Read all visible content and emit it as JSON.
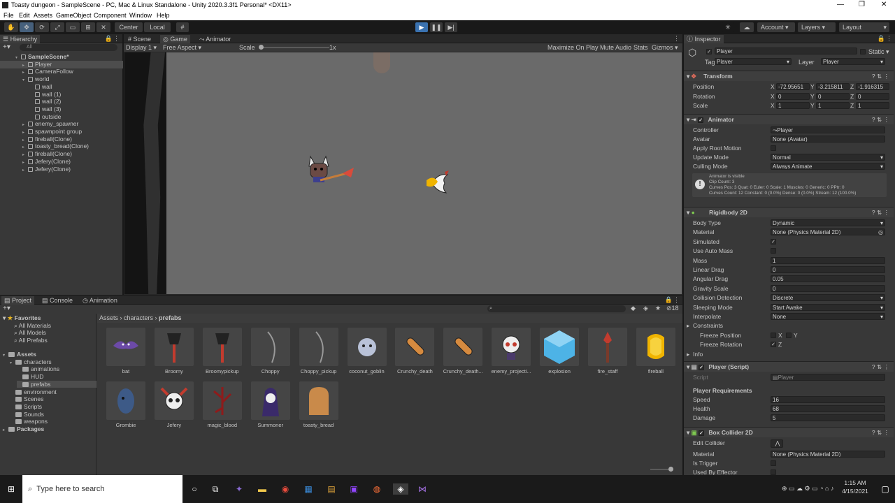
{
  "window": {
    "title": "Toasty dungeon - SampleScene - PC, Mac & Linux Standalone - Unity 2020.3.3f1 Personal* <DX11>"
  },
  "menu": [
    "File",
    "Edit",
    "Assets",
    "GameObject",
    "Component",
    "Window",
    "Help"
  ],
  "toolbar": {
    "center": "Center",
    "local": "Local",
    "account": "Account",
    "layers": "Layers",
    "layout": "Layout"
  },
  "hierarchy": {
    "title": "Hierarchy",
    "search_placeholder": "All",
    "items": [
      {
        "label": "SampleScene*",
        "indent": 0
      },
      {
        "label": "Player",
        "indent": 1
      },
      {
        "label": "CameraFollow",
        "indent": 1
      },
      {
        "label": "world",
        "indent": 1
      },
      {
        "label": "wall",
        "indent": 2
      },
      {
        "label": "wall (1)",
        "indent": 2
      },
      {
        "label": "wall (2)",
        "indent": 2
      },
      {
        "label": "wall (3)",
        "indent": 2
      },
      {
        "label": "outside",
        "indent": 2
      },
      {
        "label": "enemy_spawner",
        "indent": 1
      },
      {
        "label": "spawnpoint group",
        "indent": 1
      },
      {
        "label": "fireball(Clone)",
        "indent": 1
      },
      {
        "label": "toasty_bread(Clone)",
        "indent": 1
      },
      {
        "label": "fireball(Clone)",
        "indent": 1
      },
      {
        "label": "Jefery(Clone)",
        "indent": 1
      },
      {
        "label": "Jefery(Clone)",
        "indent": 1
      }
    ]
  },
  "game": {
    "tabs": [
      "Scene",
      "Game",
      "Animator"
    ],
    "display": "Display 1",
    "aspect": "Free Aspect",
    "scale_label": "Scale",
    "scale_value": "1x",
    "scale_level": 0.02,
    "options": [
      "Maximize On Play",
      "Mute Audio",
      "Stats",
      "Gizmos"
    ]
  },
  "project": {
    "tabs": [
      "Project",
      "Console",
      "Animation"
    ],
    "breadcrumb": [
      "Assets",
      "characters",
      "prefabs"
    ],
    "count": "18",
    "favorites": {
      "label": "Favorites",
      "items": [
        "All Materials",
        "All Models",
        "All Prefabs"
      ]
    },
    "tree": [
      {
        "label": "Assets",
        "indent": 0
      },
      {
        "label": "characters",
        "indent": 1
      },
      {
        "label": "animations",
        "indent": 2
      },
      {
        "label": "HUD",
        "indent": 2
      },
      {
        "label": "prefabs",
        "indent": 2
      },
      {
        "label": "environment",
        "indent": 1
      },
      {
        "label": "Scenes",
        "indent": 1
      },
      {
        "label": "Scripts",
        "indent": 1
      },
      {
        "label": "Sounds",
        "indent": 1
      },
      {
        "label": "weapons",
        "indent": 1
      },
      {
        "label": "Packages",
        "indent": 0
      }
    ],
    "assets": [
      {
        "name": "bat",
        "icon": "bat-sprite"
      },
      {
        "name": "Broomy",
        "icon": "broom-sprite"
      },
      {
        "name": "Broomypickup",
        "icon": "broom-sprite"
      },
      {
        "name": "Choppy",
        "icon": "sword-sprite"
      },
      {
        "name": "Choppy_pickup",
        "icon": "sword-sprite"
      },
      {
        "name": "coconut_goblin",
        "icon": "goblin-sprite"
      },
      {
        "name": "Crunchy_death",
        "icon": "bread-sprite"
      },
      {
        "name": "Crunchy_death...",
        "icon": "bread-sprite"
      },
      {
        "name": "enemy_projecti...",
        "icon": "skull-sprite"
      },
      {
        "name": "explosion",
        "icon": "cube-sprite"
      },
      {
        "name": "fire_staff",
        "icon": "staff-sprite"
      },
      {
        "name": "fireball",
        "icon": "fireball-sprite"
      },
      {
        "name": "Grombie",
        "icon": "zombie-sprite"
      },
      {
        "name": "Jefery",
        "icon": "horned-skull-sprite"
      },
      {
        "name": "magic_blood",
        "icon": "blood-sprite"
      },
      {
        "name": "Summoner",
        "icon": "summoner-sprite"
      },
      {
        "name": "toasty_bread",
        "icon": "toast-sprite"
      }
    ]
  },
  "inspector": {
    "title": "Inspector",
    "object_name": "Player",
    "static_label": "Static",
    "tag_label": "Tag",
    "tag": "Player",
    "layer_label": "Layer",
    "layer": "Player",
    "transform": {
      "title": "Transform",
      "position_label": "Position",
      "rotation_label": "Rotation",
      "scale_label": "Scale",
      "position": [
        "-72.95651",
        "-3.215811",
        "-1.916315"
      ],
      "rotation": [
        "0",
        "0",
        "0"
      ],
      "scale": [
        "1",
        "1",
        "1"
      ]
    },
    "animator": {
      "title": "Animator",
      "controller_label": "Controller",
      "controller": "Player",
      "avatar_label": "Avatar",
      "avatar": "None (Avatar)",
      "root_label": "Apply Root Motion",
      "update_label": "Update Mode",
      "update": "Normal",
      "culling_label": "Culling Mode",
      "culling": "Always Animate",
      "info": [
        "Animator is visible",
        "Clip Count: 3",
        "Curves Pos: 3 Quat: 0 Euler: 0 Scale: 1 Muscles: 0 Generic: 0 PPtr: 0",
        "Curves Count: 12 Constant: 0 (0.0%) Dense: 0 (0.0%) Stream: 12 (100.0%)"
      ]
    },
    "rigidbody": {
      "title": "Rigidbody 2D",
      "body_type_label": "Body Type",
      "body_type": "Dynamic",
      "material_label": "Material",
      "material": "None (Physics Material 2D)",
      "simulated_label": "Simulated",
      "auto_mass_label": "Use Auto Mass",
      "mass_label": "Mass",
      "mass": "1",
      "ldrag_label": "Linear Drag",
      "ldrag": "0",
      "adrag_label": "Angular Drag",
      "adrag": "0.05",
      "grav_label": "Gravity Scale",
      "grav": "0",
      "coll_label": "Collision Detection",
      "coll": "Discrete",
      "sleep_label": "Sleeping Mode",
      "sleep": "Start Awake",
      "interp_label": "Interpolate",
      "interp": "None",
      "constraints_label": "Constraints",
      "freeze_pos_label": "Freeze Position",
      "freeze_rot_label": "Freeze Rotation",
      "x": "X",
      "y": "Y",
      "z": "Z",
      "info_label": "Info"
    },
    "script": {
      "title": "Player (Script)",
      "script_label": "Script",
      "script": "Player",
      "section": "Player Requirements",
      "speed_label": "Speed",
      "speed": "16",
      "health_label": "Health",
      "health": "68",
      "damage_label": "Damage",
      "damage": "5"
    },
    "boxcollider": {
      "title": "Box Collider 2D",
      "edit_label": "Edit Collider",
      "material_label": "Material",
      "material": "None (Physics Material 2D)",
      "trigger_label": "Is Trigger",
      "effector_label": "Used By Effector"
    }
  },
  "taskbar": {
    "search_placeholder": "Type here to search",
    "time": "1:15 AM",
    "date": "4/15/2021"
  },
  "colors": {
    "accent": "#3a72b0",
    "panel": "#383838",
    "dark": "#191919",
    "game_bg": "#6a6a6a"
  }
}
